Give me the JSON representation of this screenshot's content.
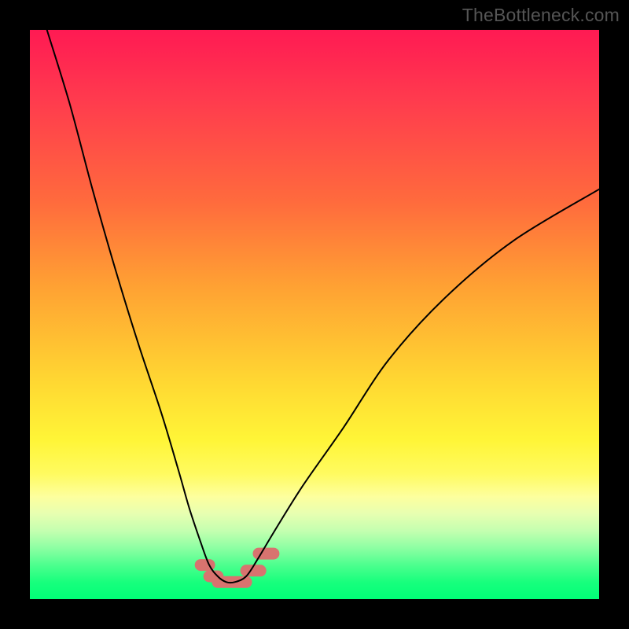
{
  "watermark": "TheBottleneck.com",
  "chart_data": {
    "type": "line",
    "title": "",
    "xlabel": "",
    "ylabel": "",
    "xlim": [
      0,
      100
    ],
    "ylim": [
      0,
      100
    ],
    "series": [
      {
        "name": "bottleneck-curve",
        "x": [
          3,
          7,
          11,
          15,
          19,
          23,
          26,
          28,
          30,
          31.5,
          33,
          34.5,
          36,
          38,
          40,
          43,
          48,
          55,
          63,
          73,
          85,
          100
        ],
        "values": [
          100,
          87,
          72,
          58,
          45,
          33,
          23,
          16,
          10,
          6,
          4,
          3,
          3,
          4,
          7,
          12,
          20,
          30,
          42,
          53,
          63,
          72
        ]
      }
    ],
    "annotations": [
      {
        "name": "floor-marker",
        "shape": "pill",
        "color": "#d8736f",
        "segments": [
          {
            "x_start": 30.0,
            "x_end": 31.5,
            "y": 6
          },
          {
            "x_start": 31.5,
            "x_end": 33.0,
            "y": 4
          },
          {
            "x_start": 33.0,
            "x_end": 38.0,
            "y": 3
          },
          {
            "x_start": 38.0,
            "x_end": 40.5,
            "y": 5
          },
          {
            "x_start": 40.2,
            "x_end": 42.8,
            "y": 8
          }
        ]
      }
    ]
  }
}
